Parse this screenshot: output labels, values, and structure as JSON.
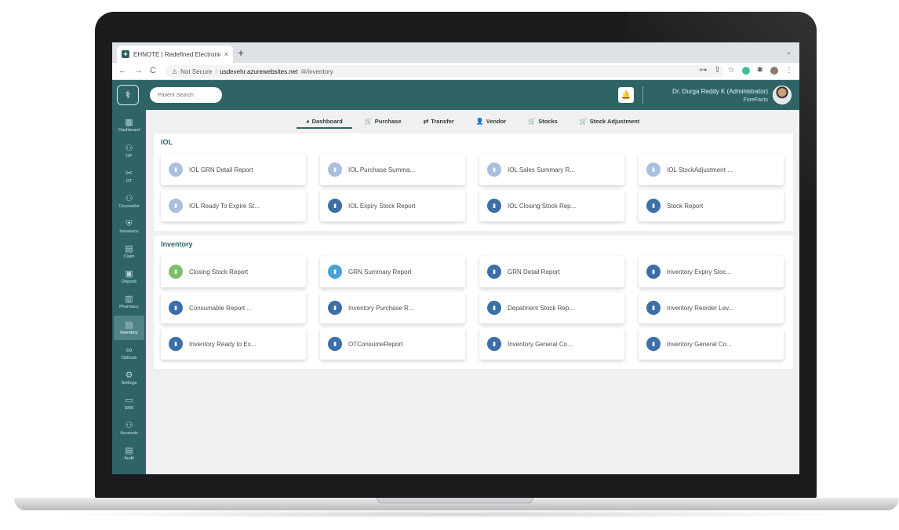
{
  "browser": {
    "tab_title": "EHNOTE | Redefined Electronic",
    "tab_close": "×",
    "new_tab": "+",
    "tab_menu": "⌄",
    "nav_back": "←",
    "nav_forward": "→",
    "nav_reload": "C",
    "security_label": "Not Secure",
    "url_host": "usdevehr.azurewebsites.net",
    "url_path": "/#/inventory"
  },
  "header": {
    "search_placeholder": "Patient Search",
    "user_name": "Dr. Durga Reddy K (Administrator)",
    "user_org": "ForeFacts"
  },
  "sidebar": {
    "items": [
      {
        "label": "Dashboard",
        "icon": "dashboard-icon",
        "glyph": "▦"
      },
      {
        "label": "OP",
        "icon": "user-icon",
        "glyph": "⚇"
      },
      {
        "label": "OT",
        "icon": "ot-icon",
        "glyph": "✂"
      },
      {
        "label": "Counsellor",
        "icon": "counsellor-icon",
        "glyph": "⚇"
      },
      {
        "label": "Insurance",
        "icon": "insurance-icon",
        "glyph": "⛨"
      },
      {
        "label": "Claim",
        "icon": "claim-icon",
        "glyph": "▤"
      },
      {
        "label": "Deposit",
        "icon": "deposit-icon",
        "glyph": "▣"
      },
      {
        "label": "Pharmacy",
        "icon": "pharmacy-icon",
        "glyph": "▥"
      },
      {
        "label": "Inventory",
        "icon": "inventory-icon",
        "glyph": "▤"
      },
      {
        "label": "Opticals",
        "icon": "glasses-icon",
        "glyph": "∞"
      },
      {
        "label": "Settings",
        "icon": "gear-icon",
        "glyph": "⚙"
      },
      {
        "label": "SMS",
        "icon": "message-icon",
        "glyph": "▭"
      },
      {
        "label": "Accounts",
        "icon": "accounts-icon",
        "glyph": "⚇"
      },
      {
        "label": "Audit",
        "icon": "audit-icon",
        "glyph": "▤"
      }
    ],
    "active_index": 8
  },
  "subnav": {
    "items": [
      {
        "label": "Dashboard",
        "glyph": "◕"
      },
      {
        "label": "Purchase",
        "glyph": "🛒"
      },
      {
        "label": "Transfer",
        "glyph": "⇄"
      },
      {
        "label": "Vendor",
        "glyph": "👤"
      },
      {
        "label": "Stocks",
        "glyph": "🛒"
      },
      {
        "label": "Stock Adjustment",
        "glyph": "🛒"
      }
    ],
    "active_index": 0
  },
  "sections": [
    {
      "title": "IOL",
      "cards": [
        {
          "label": "IOL GRN Detail Report",
          "color": "#a9bfdd"
        },
        {
          "label": "IOL Purchase Summa...",
          "color": "#a9bfdd"
        },
        {
          "label": "IOL Sales Summary R...",
          "color": "#a9bfdd"
        },
        {
          "label": "IOL StockAdjustment ...",
          "color": "#a9bfdd"
        },
        {
          "label": "IOL Ready To Expire St...",
          "color": "#a9bfdd"
        },
        {
          "label": "IOL Expiry Stock Report",
          "color": "#3d6fa7"
        },
        {
          "label": "IOL Closing Stock Rep...",
          "color": "#3d6fa7"
        },
        {
          "label": "Stock Report",
          "color": "#3d6fa7"
        }
      ]
    },
    {
      "title": "Inventory",
      "cards": [
        {
          "label": "Closing Stock Report",
          "color": "#7cbf6b"
        },
        {
          "label": "GRN Summary Report",
          "color": "#4aa3d3"
        },
        {
          "label": "GRN Detail Report",
          "color": "#3d6fa7"
        },
        {
          "label": "Inventory Expiry Stoc...",
          "color": "#3d6fa7"
        },
        {
          "label": "Consumable Report ...",
          "color": "#3d6fa7"
        },
        {
          "label": "Inventory Purchase R...",
          "color": "#3d6fa7"
        },
        {
          "label": "Depatment Stock Rep...",
          "color": "#3d6fa7"
        },
        {
          "label": "Inventory Reorder Lev...",
          "color": "#3d6fa7"
        },
        {
          "label": "Inventory Ready to Ex...",
          "color": "#3d6fa7"
        },
        {
          "label": "OTConsumeReport",
          "color": "#3d6fa7"
        },
        {
          "label": "Inventory General Co...",
          "color": "#3d6fa7"
        },
        {
          "label": "Inventory General Co...",
          "color": "#3d6fa7"
        }
      ]
    }
  ]
}
